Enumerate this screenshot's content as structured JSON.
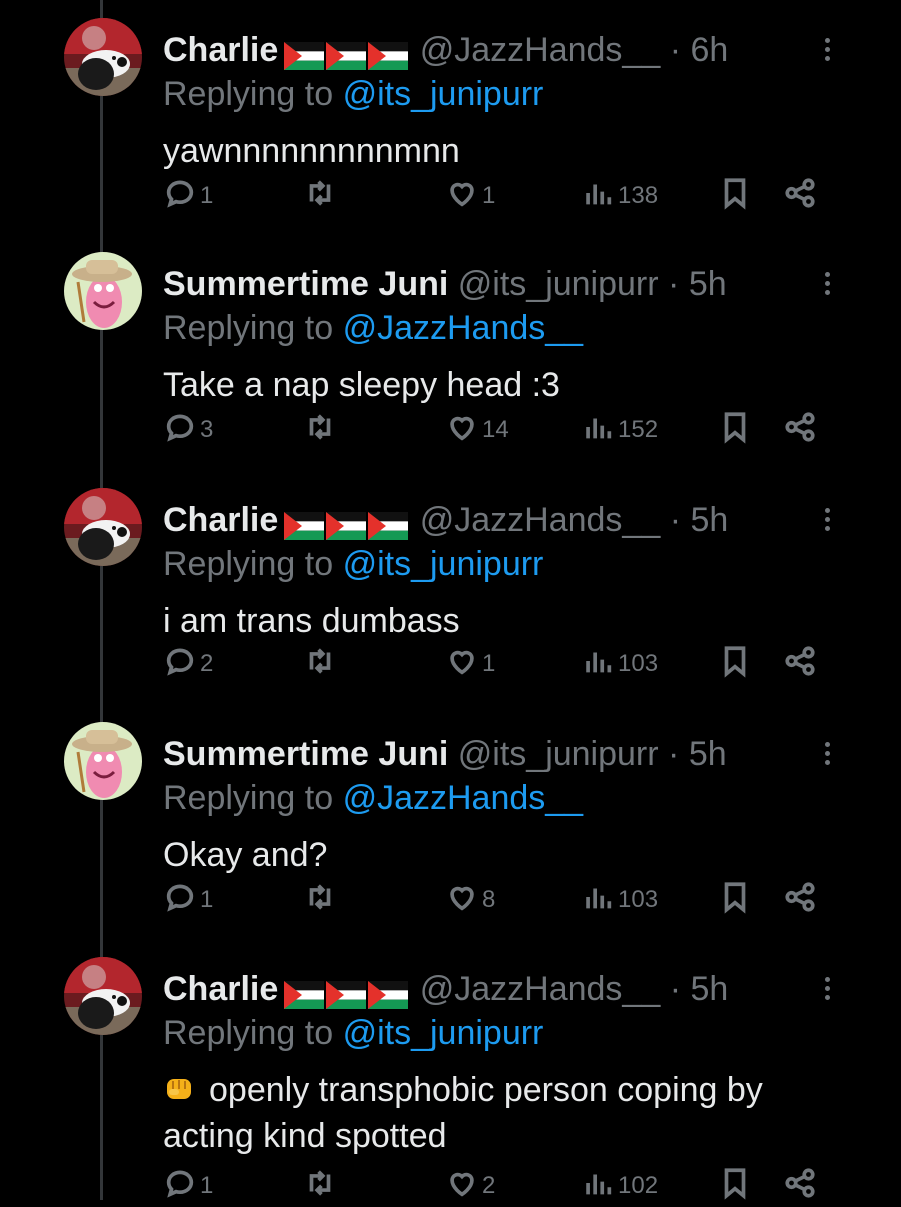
{
  "posts": [
    {
      "name": "Charlie",
      "has_flags": true,
      "handle": "@JazzHands__",
      "dot": "·",
      "time": "6h",
      "replying_prefix": "Replying to",
      "replying_to": "@its_junipurr",
      "text": "yawnnnnnnnnnmnn",
      "replies": "1",
      "retweets": "",
      "likes": "1",
      "views": "138"
    },
    {
      "name": "Summertime Juni",
      "has_flags": false,
      "handle": "@its_junipurr",
      "dot": "·",
      "time": "5h",
      "replying_prefix": "Replying to",
      "replying_to": "@JazzHands__",
      "text": "Take a nap sleepy head :3",
      "replies": "3",
      "retweets": "",
      "likes": "14",
      "views": "152"
    },
    {
      "name": "Charlie",
      "has_flags": true,
      "handle": "@JazzHands__",
      "dot": "·",
      "time": "5h",
      "replying_prefix": "Replying to",
      "replying_to": "@its_junipurr",
      "text": "i am trans dumbass",
      "replies": "2",
      "retweets": "",
      "likes": "1",
      "views": "103"
    },
    {
      "name": "Summertime Juni",
      "has_flags": false,
      "handle": "@its_junipurr",
      "dot": "·",
      "time": "5h",
      "replying_prefix": "Replying to",
      "replying_to": "@JazzHands__",
      "text": "Okay and?",
      "replies": "1",
      "retweets": "",
      "likes": "8",
      "views": "103"
    },
    {
      "name": "Charlie",
      "has_flags": true,
      "handle": "@JazzHands__",
      "dot": "·",
      "time": "5h",
      "replying_prefix": "Replying to",
      "replying_to": "@its_junipurr",
      "text": "openly transphobic person coping by acting kind spotted",
      "has_emoji": true,
      "emoji": "oncoming-fist",
      "replies": "1",
      "retweets": "",
      "likes": "2",
      "views": "102"
    }
  ],
  "colors": {
    "background": "#000000",
    "text": "#e7e9ea",
    "muted": "#71767b",
    "link": "#1d9bf0",
    "thread_line": "#333639"
  },
  "icons": {
    "reply": "reply-bubble-icon",
    "retweet": "retweet-icon",
    "like": "heart-icon",
    "views": "views-bar-chart-icon",
    "bookmark": "bookmark-icon",
    "share": "share-icon",
    "more": "more-vertical-icon",
    "flag": "palestine-flag-icon"
  }
}
